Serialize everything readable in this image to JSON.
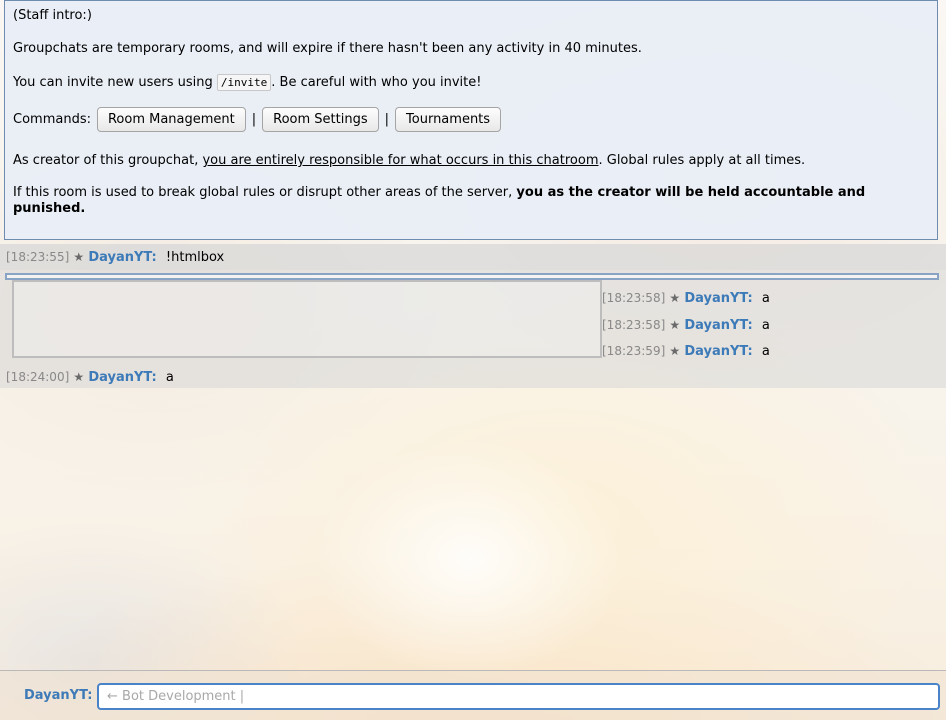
{
  "staff_intro": {
    "heading": "(Staff intro:)",
    "line1": "Groupchats are temporary rooms, and will expire if there hasn't been any activity in 40 minutes.",
    "line2_before": "You can invite new users using ",
    "line2_code": "/invite",
    "line2_after": ". Be careful with who you invite!",
    "commands_label": "Commands:",
    "buttons": [
      "Room Management",
      "Room Settings",
      "Tournaments"
    ],
    "separator": "|",
    "line4_before": "As creator of this groupchat, ",
    "line4_underlined": "you are entirely responsible for what occurs in this chatroom",
    "line4_after": ". Global rules apply at all times.",
    "line5_before": "If this room is used to break global rules or disrupt other areas of the server, ",
    "line5_bold": "you as the creator will be held accountable and punished",
    "line5_after": "."
  },
  "messages": [
    {
      "time": "[18:23:55]",
      "star": "★",
      "user": "DayanYT:",
      "text": "!htmlbox"
    },
    {
      "time": "[18:23:58]",
      "star": "★",
      "user": "DayanYT:",
      "text": "a"
    },
    {
      "time": "[18:23:58]",
      "star": "★",
      "user": "DayanYT:",
      "text": "a"
    },
    {
      "time": "[18:23:59]",
      "star": "★",
      "user": "DayanYT:",
      "text": "a"
    },
    {
      "time": "[18:24:00]",
      "star": "★",
      "user": "DayanYT:",
      "text": "a"
    }
  ],
  "composer": {
    "user": "DayanYT:",
    "placeholder": "← Bot Development |"
  },
  "colors": {
    "username": "#3d7ab8",
    "intro_border": "#6f8bb0",
    "input_border": "#4a83c7"
  }
}
